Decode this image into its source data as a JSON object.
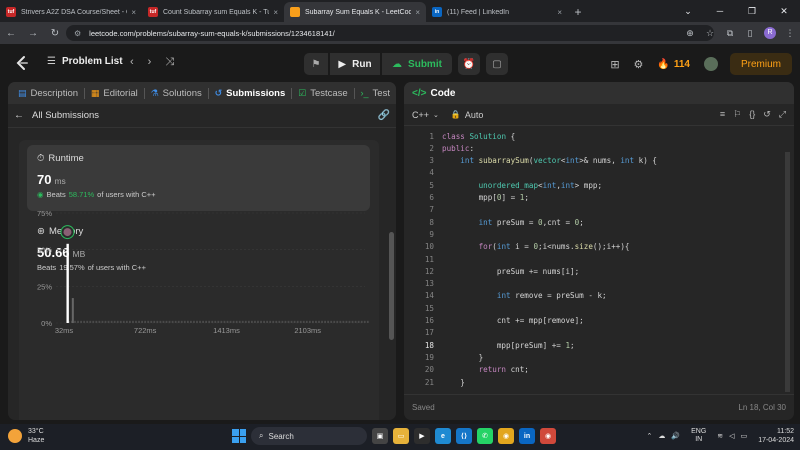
{
  "browser": {
    "tabs": [
      {
        "title": "Strivers A2Z DSA Course/Sheet - C",
        "favicon_color": "#c62828",
        "favicon_text": "tuf"
      },
      {
        "title": "Count Subarray sum Equals K - Tu",
        "favicon_color": "#c62828",
        "favicon_text": "tuf"
      },
      {
        "title": "Subarray Sum Equals K - LeetCode",
        "favicon_color": "#f89f1b",
        "favicon_text": "",
        "active": true
      },
      {
        "title": "(11) Feed | LinkedIn",
        "favicon_color": "#0a66c2",
        "favicon_text": "in"
      }
    ],
    "new_tab": "+",
    "close_glyph": "×",
    "window_controls": [
      "⌄",
      "─",
      "❐",
      "✕"
    ],
    "url": "leetcode.com/problems/subarray-sum-equals-k/submissions/1234618141/",
    "profile_initial": "R"
  },
  "header": {
    "problem_list": "Problem List",
    "run": "Run",
    "submit": "Submit",
    "streak": "114",
    "premium": "Premium"
  },
  "left": {
    "tabs": [
      {
        "label": "Description",
        "icon": "description-icon"
      },
      {
        "label": "Editorial",
        "icon": "editorial-icon"
      },
      {
        "label": "Solutions",
        "icon": "solutions-icon"
      },
      {
        "label": "Submissions",
        "icon": "submissions-icon",
        "active": true
      },
      {
        "label": "Testcase",
        "icon": "testcase-icon"
      },
      {
        "label": "Test",
        "icon": "test-icon"
      }
    ],
    "all_submissions": "All Submissions",
    "runtime": {
      "title": "Runtime",
      "value": "70",
      "unit": "ms",
      "beats_prefix": "Beats",
      "beats_pct": "58.71%",
      "beats_suffix": "of users with C++"
    },
    "memory": {
      "title": "Memory",
      "value": "50.66",
      "unit": "MB",
      "beats_prefix": "Beats",
      "beats_pct": "19.57%",
      "beats_suffix": "of users with C++"
    }
  },
  "chart_data": {
    "type": "bar",
    "y_ticks": [
      "75%",
      "50%",
      "25%",
      "0%"
    ],
    "ylim": [
      0,
      75
    ],
    "x_ticks": [
      "32ms",
      "722ms",
      "1413ms",
      "2103ms"
    ],
    "xlim": [
      32,
      2590
    ],
    "user_value_ms": 70,
    "user_marker_pct": 62,
    "bars": [
      {
        "x": 70,
        "pct": 54
      },
      {
        "x": 90,
        "pct": 17
      }
    ],
    "baseline_bar_pct": 1.5,
    "colors": {
      "highlight": "#ffffff",
      "bar": "#4a4a4a",
      "grid": "#3a3a3a"
    }
  },
  "right": {
    "title": "Code",
    "language": "C++",
    "mode": "Auto",
    "status_saved": "Saved",
    "cursor_pos": "Ln 18, Col 30",
    "active_line": 18,
    "code_lines": [
      "class Solution {",
      "public:",
      "    int subarraySum(vector<int>& nums, int k) {",
      "",
      "        unordered_map<int,int> mpp;",
      "        mpp[0] = 1;",
      "",
      "        int preSum = 0,cnt = 0;",
      "",
      "        for(int i = 0;i<nums.size();i++){",
      "",
      "            preSum += nums[i];",
      "",
      "            int remove = preSum - k;",
      "",
      "            cnt += mpp[remove];",
      "",
      "            mpp[preSum] += 1;",
      "        }",
      "        return cnt;",
      "    }"
    ]
  },
  "taskbar": {
    "temp": "33°C",
    "weather": "Haze",
    "search": "Search",
    "lang_top": "ENG",
    "lang_bottom": "IN",
    "time": "11:52",
    "date": "17-04-2024"
  }
}
